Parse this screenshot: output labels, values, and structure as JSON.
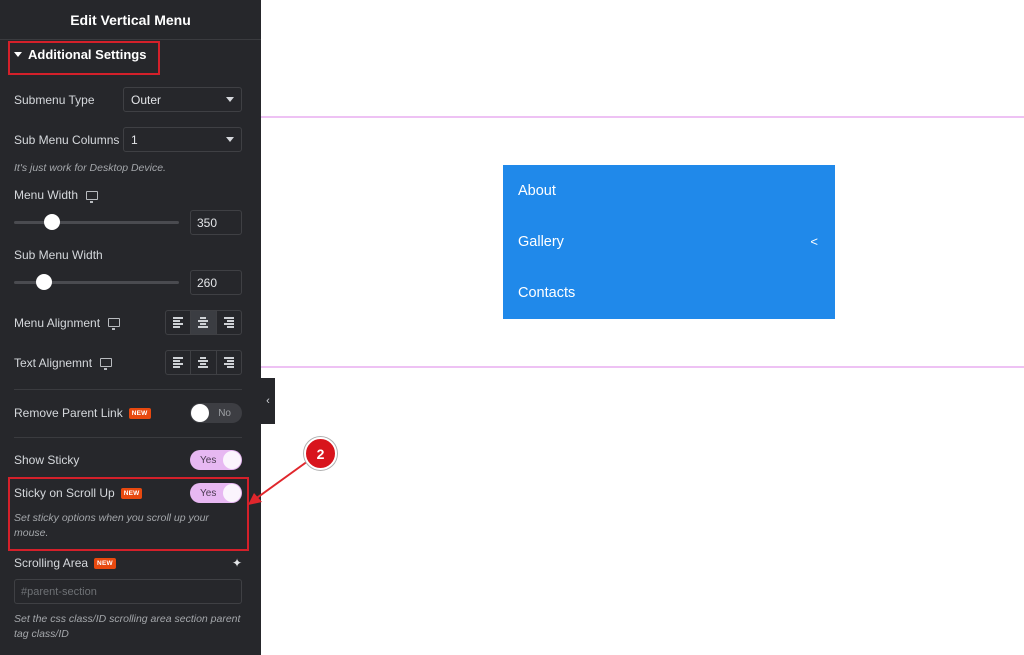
{
  "panel": {
    "title": "Edit Vertical Menu",
    "section_title": "Additional Settings",
    "submenu_type": {
      "label": "Submenu Type",
      "value": "Outer"
    },
    "submenu_columns": {
      "label": "Sub Menu Columns",
      "value": "1",
      "note": "It's just work for Desktop Device."
    },
    "menu_width": {
      "label": "Menu Width",
      "value": "350",
      "slider_fraction": 0.23
    },
    "submenu_width": {
      "label": "Sub Menu Width",
      "value": "260",
      "slider_fraction": 0.18
    },
    "menu_alignment": {
      "label": "Menu Alignment",
      "options": [
        "left",
        "center",
        "right"
      ],
      "selected": "center"
    },
    "text_alignment": {
      "label": "Text Alignemnt",
      "options": [
        "left",
        "center",
        "right"
      ],
      "selected": null
    },
    "remove_parent_link": {
      "label": "Remove Parent Link",
      "badge": "NEW",
      "state": "No"
    },
    "show_sticky": {
      "label": "Show Sticky",
      "state": "Yes"
    },
    "sticky_scroll_up": {
      "label": "Sticky on Scroll Up",
      "badge": "NEW",
      "state": "Yes",
      "note": "Set sticky options when you scroll up your mouse."
    },
    "scrolling_area": {
      "label": "Scrolling Area",
      "badge": "NEW",
      "placeholder": "#parent-section",
      "value": "",
      "note": "Set the css class/ID scrolling area section parent tag class/ID"
    }
  },
  "preview": {
    "menu_items": [
      {
        "label": "About",
        "has_submenu": false
      },
      {
        "label": "Gallery",
        "has_submenu": true
      },
      {
        "label": "Contacts",
        "has_submenu": false
      }
    ],
    "menu_color": "#2089ea",
    "guide_color": "#eec2f4"
  },
  "annotation": {
    "marker": "2",
    "highlight_color": "#d4202a"
  }
}
